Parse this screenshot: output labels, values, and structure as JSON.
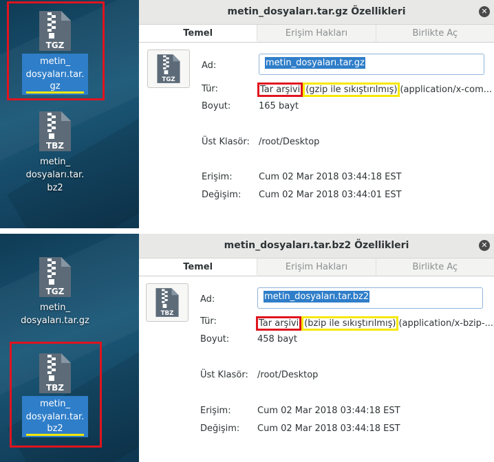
{
  "panels": [
    {
      "desktop": {
        "icons": [
          {
            "badge": "TGZ",
            "label_lines": [
              "metin_",
              "dosyaları.tar.",
              "gz"
            ],
            "underline": "gz"
          },
          {
            "badge": "TBZ",
            "label_lines": [
              "metin_",
              "dosyaları.tar.",
              "bz2"
            ]
          }
        ]
      },
      "dialog": {
        "title": "metin_dosyaları.tar.gz Özellikleri",
        "close": "✕",
        "tabs": [
          "Temel",
          "Erişim Hakları",
          "Birlikte Aç"
        ],
        "thumb_badge": "TGZ",
        "name_label": "Ad:",
        "name_value": "metin_dosyaları.tar.gz",
        "type_label": "Tür:",
        "type_part1": "Tar arşivi",
        "type_part2": "(gzip ile sıkıştırılmış)",
        "type_part3": "(application/x-com...",
        "size_label": "Boyut:",
        "size_value": "165 bayt",
        "folder_label": "Üst Klasör:",
        "folder_value": "/root/Desktop",
        "access_label": "Erişim:",
        "access_value": "Cum 02 Mar 2018 03:44:18 EST",
        "modified_label": "Değişim:",
        "modified_value": "Cum 02 Mar 2018 03:44:01 EST"
      }
    },
    {
      "desktop": {
        "icons": [
          {
            "badge": "TGZ",
            "label_lines": [
              "metin_",
              "dosyaları.tar.gz"
            ]
          },
          {
            "badge": "TBZ",
            "label_lines": [
              "metin_",
              "dosyaları.tar.",
              "bz2"
            ],
            "underline": "bz2"
          }
        ]
      },
      "dialog": {
        "title": "metin_dosyaları.tar.bz2 Özellikleri",
        "close": "✕",
        "tabs": [
          "Temel",
          "Erişim Hakları",
          "Birlikte Aç"
        ],
        "thumb_badge": "TBZ",
        "name_label": "Ad:",
        "name_value": "metin_dosyaları.tar.bz2",
        "type_label": "Tür:",
        "type_part1": "Tar arşivi",
        "type_part2": "(bzip ile sıkıştırılmış)",
        "type_part3": "(application/x-bzip-...",
        "size_label": "Boyut:",
        "size_value": "458 bayt",
        "folder_label": "Üst Klasör:",
        "folder_value": "/root/Desktop",
        "access_label": "Erişim:",
        "access_value": "Cum 02 Mar 2018 03:44:18 EST",
        "modified_label": "Değişim:",
        "modified_value": "Cum 02 Mar 2018 03:44:18 EST"
      }
    }
  ],
  "colors": {
    "highlight_red": "#e0141e",
    "highlight_yellow": "#f5e800",
    "selection_blue": "#2f7ec9"
  }
}
